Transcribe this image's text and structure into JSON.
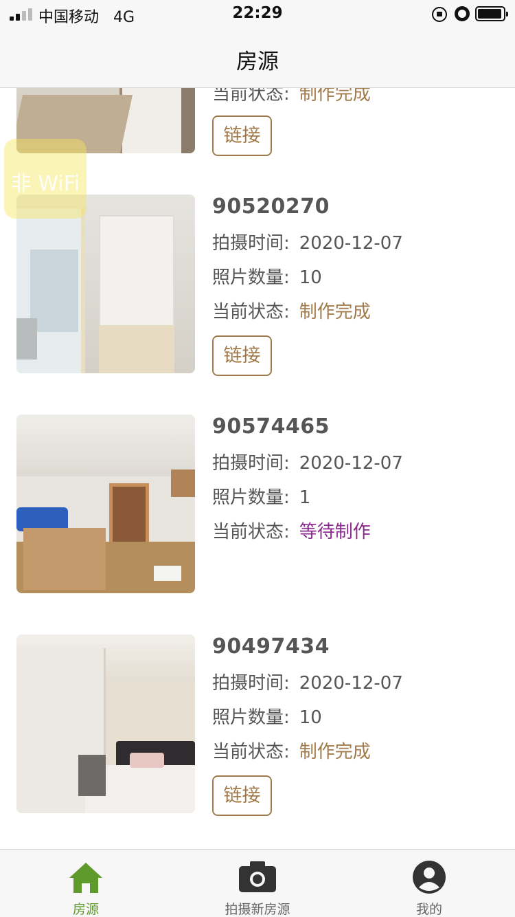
{
  "status_bar": {
    "carrier": "中国移动",
    "network": "4G",
    "time": "22:29"
  },
  "nav": {
    "title": "房源"
  },
  "listings": [
    {
      "id": "",
      "status_label": "当前状态:",
      "status": "制作完成",
      "link_label": "链接"
    },
    {
      "id": "90520270",
      "shot_time_label": "拍摄时间:",
      "shot_time": "2020-12-07",
      "photo_count_label": "照片数量:",
      "photo_count": "10",
      "status_label": "当前状态:",
      "status": "制作完成",
      "link_label": "链接"
    },
    {
      "id": "90574465",
      "shot_time_label": "拍摄时间:",
      "shot_time": "2020-12-07",
      "photo_count_label": "照片数量:",
      "photo_count": "1",
      "status_label": "当前状态:",
      "status": "等待制作"
    },
    {
      "id": "90497434",
      "shot_time_label": "拍摄时间:",
      "shot_time": "2020-12-07",
      "photo_count_label": "照片数量:",
      "photo_count": "10",
      "status_label": "当前状态:",
      "status": "制作完成",
      "link_label": "链接"
    }
  ],
  "overlay": {
    "text": "非 WiFi"
  },
  "tab_bar": {
    "tabs": [
      {
        "label": "房源",
        "icon": "home-icon",
        "active": true
      },
      {
        "label": "拍摄新房源",
        "icon": "camera-icon",
        "active": false
      },
      {
        "label": "我的",
        "icon": "user-icon",
        "active": false
      }
    ]
  },
  "colors": {
    "accent_green": "#5f9a2c",
    "status_done": "#a07a4a",
    "status_waiting": "#8a2a8e",
    "link_border": "#a07a4a"
  }
}
